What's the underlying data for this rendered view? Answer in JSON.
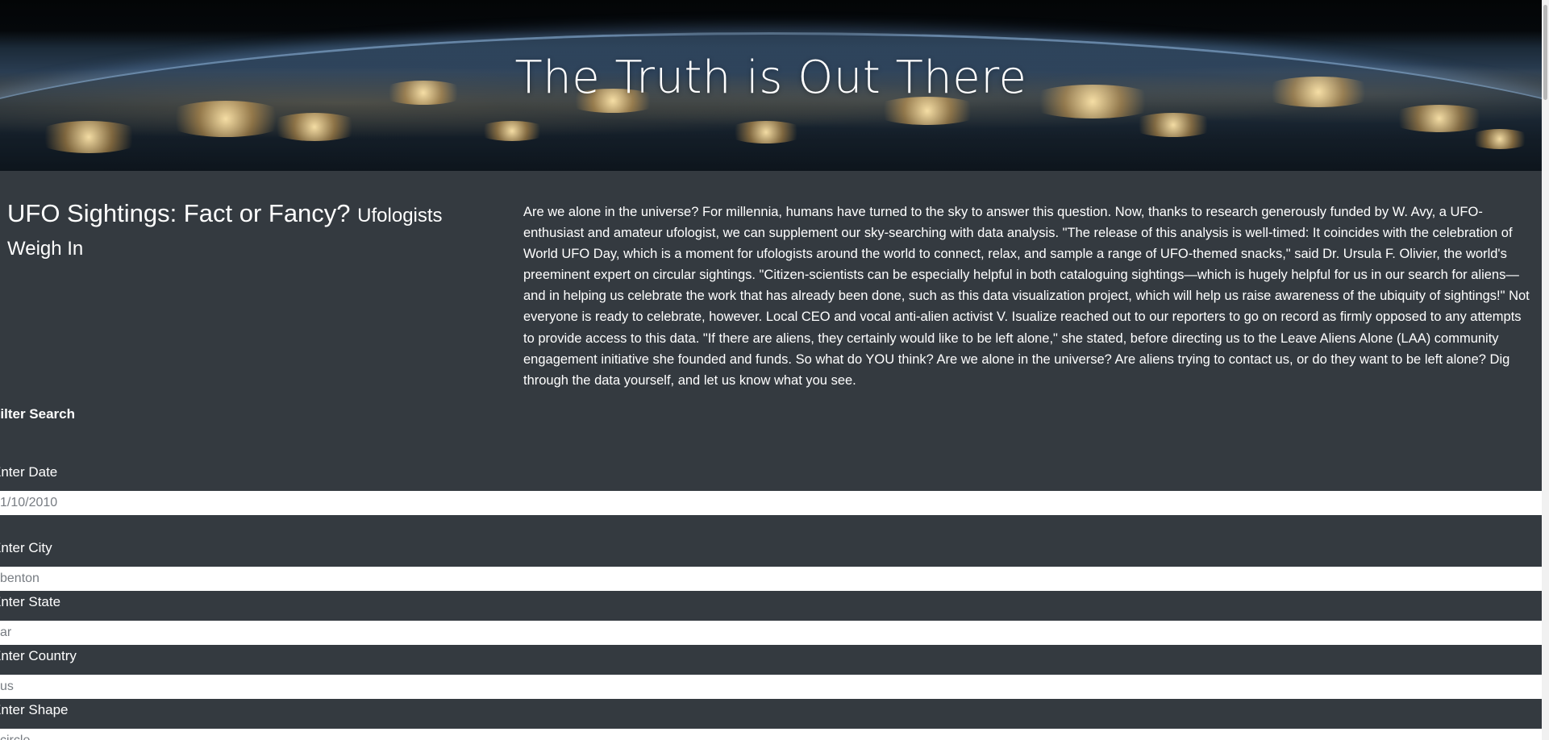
{
  "hero": {
    "title": "The Truth is Out There"
  },
  "intro": {
    "heading": "UFO Sightings: Fact or Fancy?",
    "subheading": "Ufologists Weigh In",
    "body": "Are we alone in the universe? For millennia, humans have turned to the sky to answer this question. Now, thanks to research generously funded by W. Avy, a UFO-enthusiast and amateur ufologist, we can supplement our sky-searching with data analysis. \"The release of this analysis is well-timed: It coincides with the celebration of World UFO Day, which is a moment for ufologists around the world to connect, relax, and sample a range of UFO-themed snacks,\" said Dr. Ursula F. Olivier, the world's preeminent expert on circular sightings. \"Citizen-scientists can be especially helpful in both cataloguing sightings—which is hugely helpful for us in our search for aliens—and in helping us celebrate the work that has already been done, such as this data visualization project, which will help us raise awareness of the ubiquity of sightings!\" Not everyone is ready to celebrate, however. Local CEO and vocal anti-alien activist V. Isualize reached out to our reporters to go on record as firmly opposed to any attempts to provide access to this data. \"If there are aliens, they certainly would like to be left alone,\" she stated, before directing us to the Leave Aliens Alone (LAA) community engagement initiative she founded and funds. So what do YOU think? Are we alone in the universe? Are aliens trying to contact us, or do they want to be left alone? Dig through the data yourself, and let us know what you see."
  },
  "filters": {
    "title": "Filter Search",
    "date": {
      "label": "Enter Date",
      "placeholder": "1/10/2010"
    },
    "city": {
      "label": "Enter City",
      "placeholder": "benton"
    },
    "state": {
      "label": "Enter State",
      "placeholder": "ar"
    },
    "country": {
      "label": "Enter Country",
      "placeholder": "us"
    },
    "shape": {
      "label": "Enter Shape",
      "placeholder": "circle"
    }
  },
  "colors": {
    "background": "#343a40",
    "input_background": "#ffffff",
    "text": "#ffffff"
  }
}
